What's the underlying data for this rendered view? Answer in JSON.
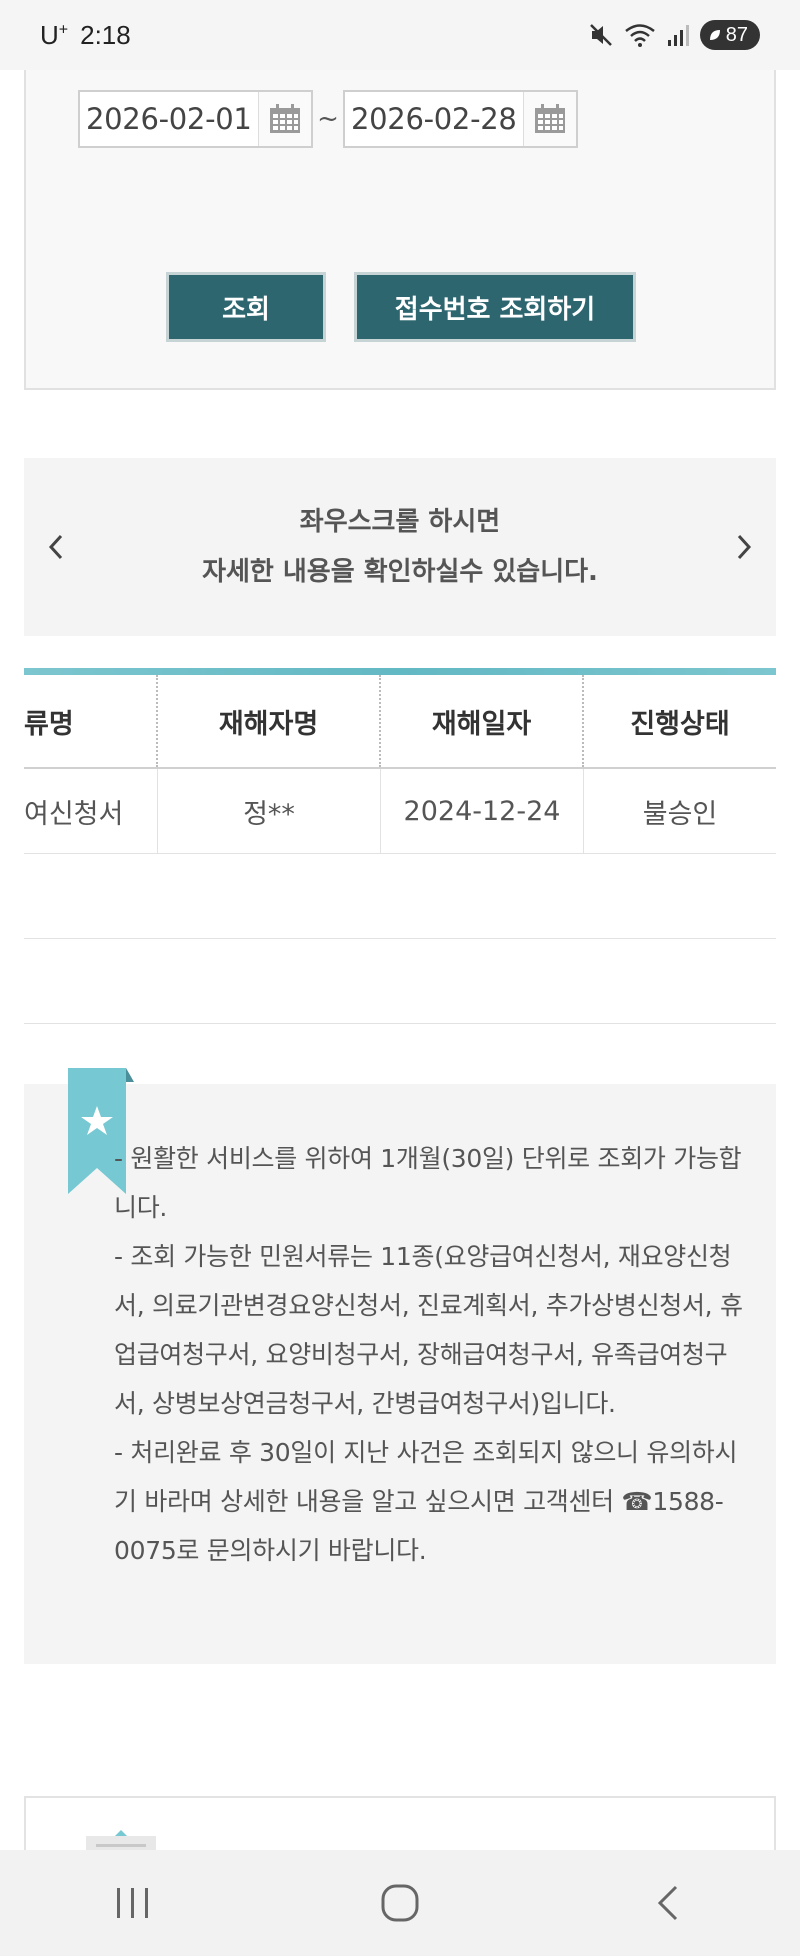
{
  "status_bar": {
    "carrier": "U",
    "carrier_sup": "+",
    "time": "2:18",
    "battery": "87"
  },
  "search": {
    "start_date": "2026-02-01",
    "end_date": "2026-02-28",
    "separator": "~",
    "search_label": "조회",
    "receipt_label": "접수번호 조회하기"
  },
  "scroll_hint": {
    "line1": "좌우스크롤 하시면",
    "line2": "자세한 내용을 확인하실수 있습니다."
  },
  "table": {
    "headers": [
      "류명",
      "재해자명",
      "재해일자",
      "진행상태"
    ],
    "rows": [
      [
        "여신청서",
        "정**",
        "2024-12-24",
        "불승인"
      ]
    ]
  },
  "notice": {
    "paragraphs": [
      "- 원활한 서비스를 위하여 1개월(30일) 단위로 조회가 가능합니다.",
      "- 조회 가능한 민원서류는 11종(요양급여신청서, 재요양신청서, 의료기관변경요양신청서, 진료계획서, 추가상병신청서, 휴업급여청구서, 요양비청구서, 장해급여청구서, 유족급여청구서, 상병보상연금청구서, 간병급여청구서)입니다.",
      "- 처리완료 후 30일이 지난 사건은 조회되지 않으니 유의하시기 바라며 상세한 내용을 알고 싶으시면 고객센터 ☎1588-0075로 문의하시기 바랍니다."
    ]
  },
  "colors": {
    "button_bg": "#2e6670",
    "table_accent": "#6dbdc7",
    "bookmark": "#76c8d2"
  }
}
